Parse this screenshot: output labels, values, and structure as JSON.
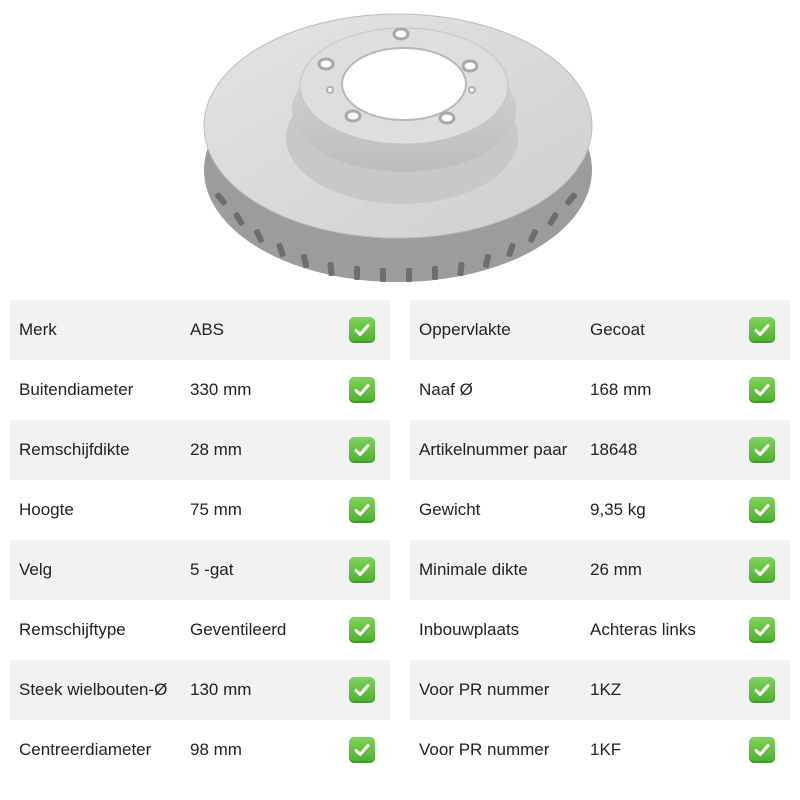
{
  "product": {
    "image_icon": "brake-disc-image"
  },
  "specs": {
    "left": [
      {
        "label": "Merk",
        "value": "ABS"
      },
      {
        "label": "Buitendiameter",
        "value": "330 mm"
      },
      {
        "label": "Remschijfdikte",
        "value": "28 mm"
      },
      {
        "label": "Hoogte",
        "value": "75 mm"
      },
      {
        "label": "Velg",
        "value": "5 -gat"
      },
      {
        "label": "Remschijftype",
        "value": "Geventileerd"
      },
      {
        "label": "Steek wielbouten-Ø",
        "value": "130 mm"
      },
      {
        "label": "Centreerdiameter",
        "value": "98 mm"
      }
    ],
    "right": [
      {
        "label": "Oppervlakte",
        "value": "Gecoat"
      },
      {
        "label": "Naaf Ø",
        "value": "168 mm"
      },
      {
        "label": "Artikelnummer paar",
        "value": "18648"
      },
      {
        "label": "Gewicht",
        "value": "9,35 kg"
      },
      {
        "label": "Minimale dikte",
        "value": "26 mm"
      },
      {
        "label": "Inbouwplaats",
        "value": "Achteras links"
      },
      {
        "label": "Voor PR nummer",
        "value": "1KZ"
      },
      {
        "label": "Voor PR nummer",
        "value": "1KF"
      }
    ],
    "check_icon": "check-mark-icon",
    "colors": {
      "shade": "#f2f2f2",
      "check": "#5cc037"
    }
  }
}
